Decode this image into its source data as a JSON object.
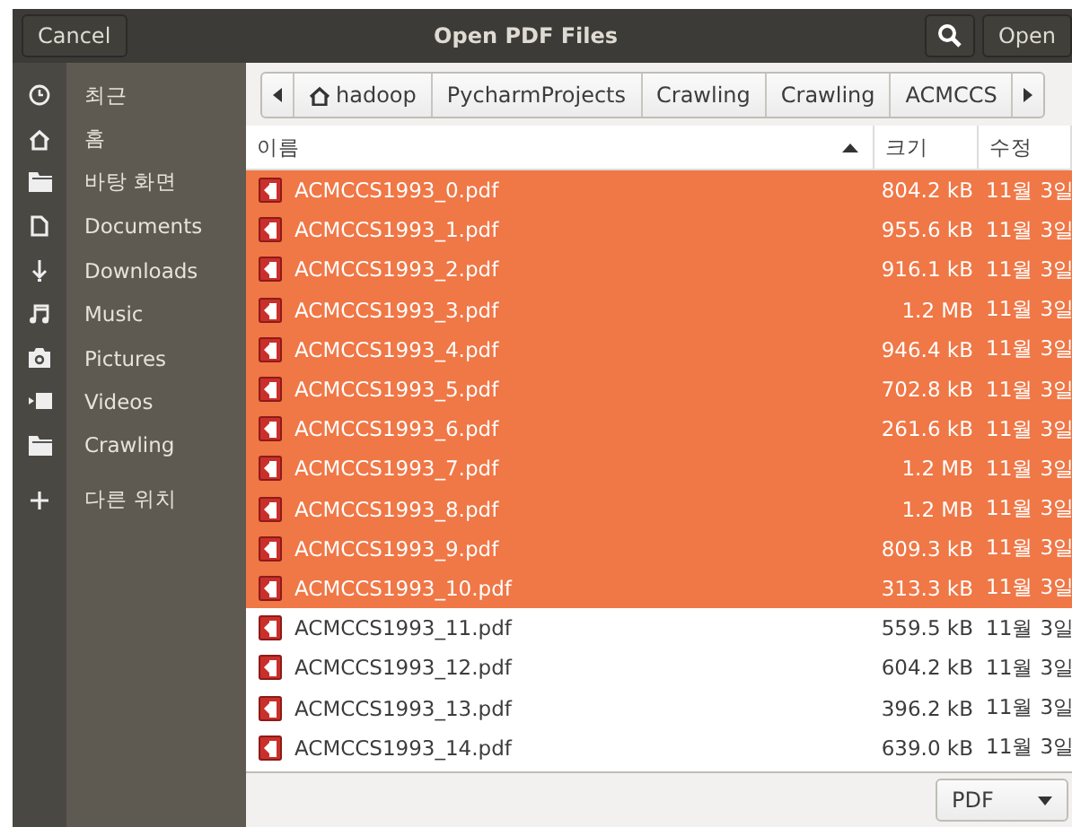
{
  "window": {
    "title": "Open PDF Files"
  },
  "header_buttons": {
    "cancel": "Cancel",
    "open": "Open"
  },
  "sidebar": {
    "items": [
      {
        "label": "최근",
        "kind": "place"
      },
      {
        "label": "홈",
        "kind": "place"
      },
      {
        "label": "바탕 화면",
        "kind": "place"
      },
      {
        "label": "Documents",
        "kind": "place"
      },
      {
        "label": "Downloads",
        "kind": "place"
      },
      {
        "label": "Music",
        "kind": "place"
      },
      {
        "label": "Pictures",
        "kind": "place"
      },
      {
        "label": "Videos",
        "kind": "place"
      },
      {
        "label": "Crawling",
        "kind": "place"
      },
      {
        "label": "다른 위치",
        "kind": "other"
      }
    ]
  },
  "path_bar": {
    "segments": [
      {
        "label": "hadoop",
        "home": true
      },
      {
        "label": "PycharmProjects",
        "home": false
      },
      {
        "label": "Crawling",
        "home": false
      },
      {
        "label": "Crawling",
        "home": false
      },
      {
        "label": "ACMCCS",
        "home": false
      }
    ]
  },
  "table": {
    "columns": [
      {
        "label": "이름",
        "sorted": true
      },
      {
        "label": "크기",
        "sorted": false
      },
      {
        "label": "수정",
        "sorted": false
      }
    ],
    "rows": [
      {
        "name": "ACMCCS1993_0.pdf",
        "size": "804.2 kB",
        "modified": "11월 3일",
        "selected": true
      },
      {
        "name": "ACMCCS1993_1.pdf",
        "size": "955.6 kB",
        "modified": "11월 3일",
        "selected": true
      },
      {
        "name": "ACMCCS1993_2.pdf",
        "size": "916.1 kB",
        "modified": "11월 3일",
        "selected": true
      },
      {
        "name": "ACMCCS1993_3.pdf",
        "size": "1.2 MB",
        "modified": "11월 3일",
        "selected": true
      },
      {
        "name": "ACMCCS1993_4.pdf",
        "size": "946.4 kB",
        "modified": "11월 3일",
        "selected": true
      },
      {
        "name": "ACMCCS1993_5.pdf",
        "size": "702.8 kB",
        "modified": "11월 3일",
        "selected": true
      },
      {
        "name": "ACMCCS1993_6.pdf",
        "size": "261.6 kB",
        "modified": "11월 3일",
        "selected": true
      },
      {
        "name": "ACMCCS1993_7.pdf",
        "size": "1.2 MB",
        "modified": "11월 3일",
        "selected": true
      },
      {
        "name": "ACMCCS1993_8.pdf",
        "size": "1.2 MB",
        "modified": "11월 3일",
        "selected": true
      },
      {
        "name": "ACMCCS1993_9.pdf",
        "size": "809.3 kB",
        "modified": "11월 3일",
        "selected": true
      },
      {
        "name": "ACMCCS1993_10.pdf",
        "size": "313.3 kB",
        "modified": "11월 3일",
        "selected": true
      },
      {
        "name": "ACMCCS1993_11.pdf",
        "size": "559.5 kB",
        "modified": "11월 3일",
        "selected": false
      },
      {
        "name": "ACMCCS1993_12.pdf",
        "size": "604.2 kB",
        "modified": "11월 3일",
        "selected": false
      },
      {
        "name": "ACMCCS1993_13.pdf",
        "size": "396.2 kB",
        "modified": "11월 3일",
        "selected": false
      },
      {
        "name": "ACMCCS1993_14.pdf",
        "size": "639.0 kB",
        "modified": "11월 3일",
        "selected": false
      }
    ]
  },
  "filter": {
    "value": "PDF"
  }
}
